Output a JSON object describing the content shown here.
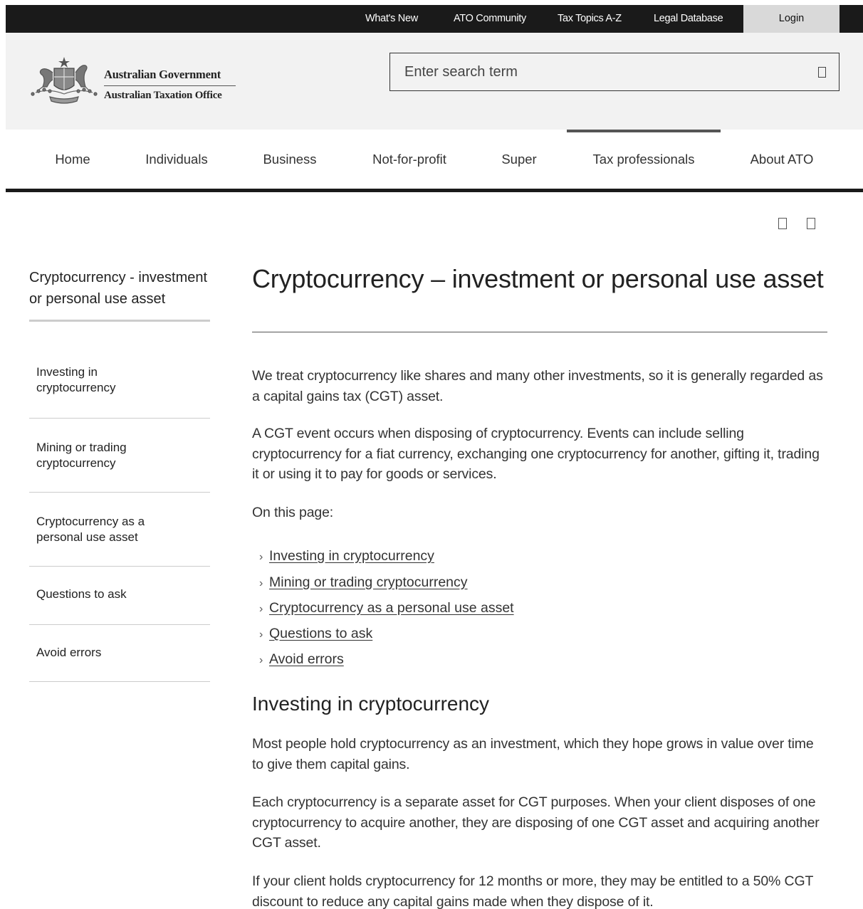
{
  "utility_nav": {
    "whats_new": "What's New",
    "ato_community": "ATO Community",
    "tax_topics": "Tax Topics A-Z",
    "legal_database": "Legal Database",
    "login": "Login"
  },
  "logo": {
    "gov_name": "Australian Government",
    "agency_name": "Australian Taxation Office"
  },
  "search": {
    "placeholder": "Enter search term",
    "icon": "search-icon"
  },
  "main_nav": {
    "items": [
      "Home",
      "Individuals",
      "Business",
      "Not-for-profit",
      "Super",
      "Tax professionals",
      "About ATO"
    ],
    "active": "Tax professionals"
  },
  "page_tools": {
    "icons": [
      "print-icon",
      "share-icon"
    ]
  },
  "sidebar": {
    "title": "Cryptocurrency - investment or personal use asset",
    "items": [
      "Investing in cryptocurrency",
      "Mining or trading cryptocurrency",
      "Cryptocurrency as a personal use asset",
      "Questions to ask",
      "Avoid errors"
    ]
  },
  "article": {
    "title": "Cryptocurrency – investment or personal use asset",
    "intro_1": "We treat cryptocurrency like shares and many other investments, so it is generally regarded as a capital gains tax (CGT) asset.",
    "intro_2": "A CGT event occurs when disposing of cryptocurrency. Events can include selling cryptocurrency for a fiat currency, exchanging one cryptocurrency for another, gifting it, trading it or using it to pay for goods or services.",
    "on_this_page": "On this page:",
    "toc": [
      "Investing in cryptocurrency",
      "Mining or trading cryptocurrency",
      "Cryptocurrency as a personal use asset",
      "Questions to ask",
      "Avoid errors"
    ],
    "section_1_heading": "Investing in cryptocurrency",
    "section_1_p1": "Most people hold cryptocurrency as an investment, which they hope grows in value over time to give them capital gains.",
    "section_1_p2": "Each cryptocurrency is a separate asset for CGT purposes. When your client disposes of one cryptocurrency to acquire another, they are disposing of one CGT asset and acquiring another CGT asset.",
    "section_1_p3": "If your client holds cryptocurrency for 12 months or more, they may be entitled to a 50% CGT discount to reduce any capital gains made when they dispose of it."
  }
}
